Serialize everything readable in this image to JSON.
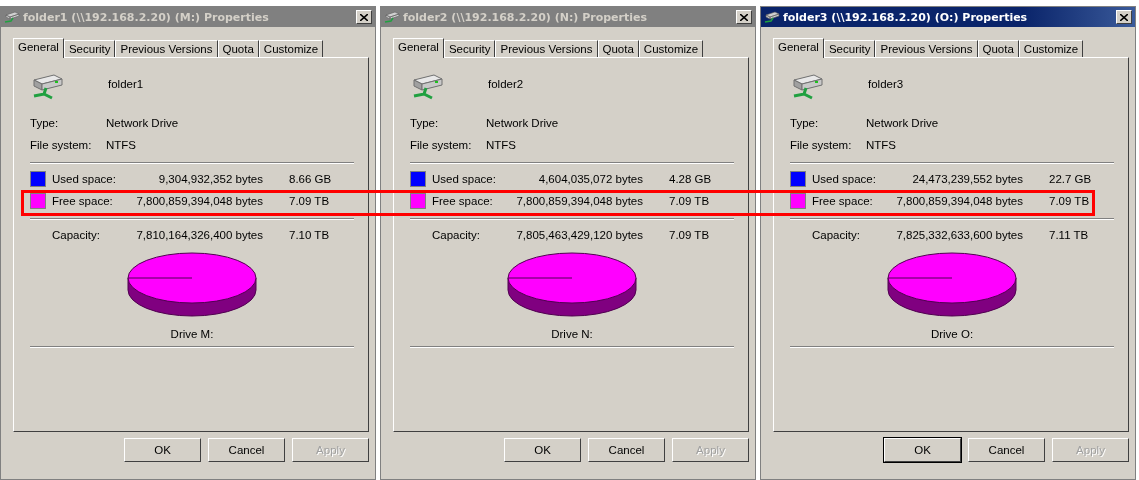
{
  "dialogs": [
    {
      "title": "folder1 (\\\\192.168.2.20) (M:) Properties",
      "active": false,
      "tabs": [
        {
          "label": "General",
          "selected": true
        },
        {
          "label": "Security",
          "selected": false
        },
        {
          "label": "Previous Versions",
          "selected": false
        },
        {
          "label": "Quota",
          "selected": false
        },
        {
          "label": "Customize",
          "selected": false
        }
      ],
      "name": "folder1",
      "details": [
        {
          "label": "Type:",
          "value": "Network Drive"
        },
        {
          "label": "File system:",
          "value": "NTFS"
        }
      ],
      "space": [
        {
          "label": "Used space:",
          "bytes": "9,304,932,352 bytes",
          "size": "8.66 GB",
          "color": "#0000ff"
        },
        {
          "label": "Free space:",
          "bytes": "7,800,859,394,048 bytes",
          "size": "7.09 TB",
          "color": "#ff00ff"
        }
      ],
      "capacity": {
        "label": "Capacity:",
        "bytes": "7,810,164,326,400 bytes",
        "size": "7.10 TB"
      },
      "drive": "Drive M:",
      "buttons": [
        {
          "label": "OK",
          "disabled": false,
          "default": false
        },
        {
          "label": "Cancel",
          "disabled": false,
          "default": false
        },
        {
          "label": "Apply",
          "disabled": true,
          "default": false
        }
      ]
    },
    {
      "title": "folder2 (\\\\192.168.2.20) (N:) Properties",
      "active": false,
      "tabs": [
        {
          "label": "General",
          "selected": true
        },
        {
          "label": "Security",
          "selected": false
        },
        {
          "label": "Previous Versions",
          "selected": false
        },
        {
          "label": "Quota",
          "selected": false
        },
        {
          "label": "Customize",
          "selected": false
        }
      ],
      "name": "folder2",
      "details": [
        {
          "label": "Type:",
          "value": "Network Drive"
        },
        {
          "label": "File system:",
          "value": "NTFS"
        }
      ],
      "space": [
        {
          "label": "Used space:",
          "bytes": "4,604,035,072 bytes",
          "size": "4.28 GB",
          "color": "#0000ff"
        },
        {
          "label": "Free space:",
          "bytes": "7,800,859,394,048 bytes",
          "size": "7.09 TB",
          "color": "#ff00ff"
        }
      ],
      "capacity": {
        "label": "Capacity:",
        "bytes": "7,805,463,429,120 bytes",
        "size": "7.09 TB"
      },
      "drive": "Drive N:",
      "buttons": [
        {
          "label": "OK",
          "disabled": false,
          "default": false
        },
        {
          "label": "Cancel",
          "disabled": false,
          "default": false
        },
        {
          "label": "Apply",
          "disabled": true,
          "default": false
        }
      ]
    },
    {
      "title": "folder3 (\\\\192.168.2.20) (O:) Properties",
      "active": true,
      "tabs": [
        {
          "label": "General",
          "selected": true
        },
        {
          "label": "Security",
          "selected": false
        },
        {
          "label": "Previous Versions",
          "selected": false
        },
        {
          "label": "Quota",
          "selected": false
        },
        {
          "label": "Customize",
          "selected": false
        }
      ],
      "name": "folder3",
      "details": [
        {
          "label": "Type:",
          "value": "Network Drive"
        },
        {
          "label": "File system:",
          "value": "NTFS"
        }
      ],
      "space": [
        {
          "label": "Used space:",
          "bytes": "24,473,239,552 bytes",
          "size": "22.7 GB",
          "color": "#0000ff"
        },
        {
          "label": "Free space:",
          "bytes": "7,800,859,394,048 bytes",
          "size": "7.09 TB",
          "color": "#ff00ff"
        }
      ],
      "capacity": {
        "label": "Capacity:",
        "bytes": "7,825,332,633,600 bytes",
        "size": "7.11 TB"
      },
      "drive": "Drive O:",
      "buttons": [
        {
          "label": "OK",
          "disabled": false,
          "default": true
        },
        {
          "label": "Cancel",
          "disabled": false,
          "default": false
        },
        {
          "label": "Apply",
          "disabled": true,
          "default": false
        }
      ]
    }
  ],
  "annotation": {
    "kind": "rectangle"
  }
}
